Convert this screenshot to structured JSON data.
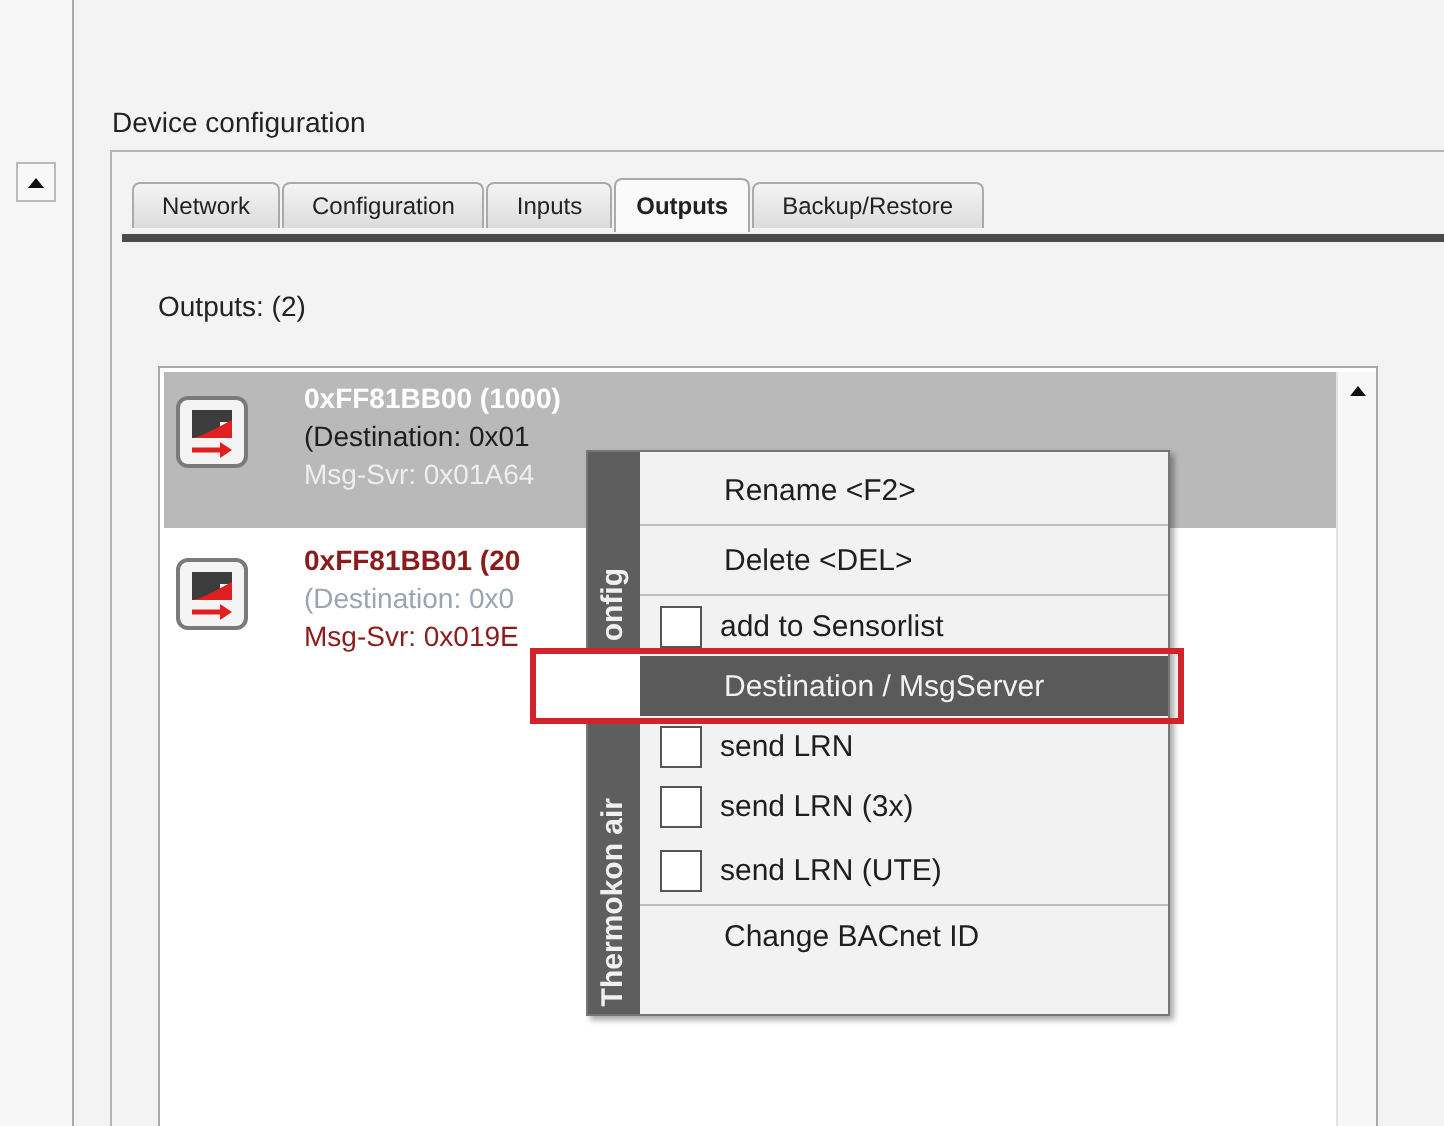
{
  "section_title": "Device configuration",
  "tabs": [
    {
      "label": "Network",
      "selected": false
    },
    {
      "label": "Configuration",
      "selected": false
    },
    {
      "label": "Inputs",
      "selected": false
    },
    {
      "label": "Outputs",
      "selected": true
    },
    {
      "label": "Backup/Restore",
      "selected": false
    }
  ],
  "outputs_label": "Outputs: (2)",
  "outputs": [
    {
      "title": "0xFF81BB00 (1000)",
      "destination": "(Destination: 0x01",
      "msg_server": "Msg-Svr: 0x01A64",
      "selected": true
    },
    {
      "title": "0xFF81BB01 (20",
      "destination": "(Destination: 0x0",
      "msg_server": "Msg-Svr: 0x019E",
      "selected": false
    }
  ],
  "context_menu": {
    "side_label_parts": [
      "Thermokon air",
      "onfig"
    ],
    "items": [
      {
        "kind": "plain",
        "label": "Rename <F2>",
        "selected": false,
        "annotated": false,
        "divider_below": true
      },
      {
        "kind": "plain",
        "label": "Delete <DEL>",
        "selected": false,
        "annotated": false,
        "divider_below": true
      },
      {
        "kind": "check",
        "label": "add to Sensorlist",
        "checked": false,
        "selected": false,
        "annotated": false,
        "divider_below": false
      },
      {
        "kind": "plain",
        "label": "Destination / MsgServer",
        "selected": true,
        "annotated": true,
        "divider_below": false
      },
      {
        "kind": "check",
        "label": "send LRN",
        "checked": false,
        "selected": false,
        "annotated": false,
        "divider_below": false
      },
      {
        "kind": "check",
        "label": "send LRN (3x)",
        "checked": false,
        "selected": false,
        "annotated": false,
        "divider_below": false
      },
      {
        "kind": "check",
        "label": "send LRN (UTE)",
        "checked": false,
        "selected": false,
        "annotated": false,
        "divider_below": true
      },
      {
        "kind": "plain",
        "label": "Change BACnet ID",
        "selected": false,
        "annotated": false,
        "divider_below": false
      }
    ]
  }
}
